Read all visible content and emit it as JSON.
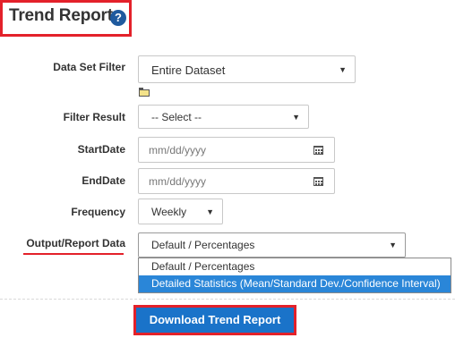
{
  "header": {
    "title": "Trend Report",
    "help_icon": "question-circle-icon"
  },
  "form": {
    "data_set_filter": {
      "label": "Data Set Filter",
      "value": "Entire Dataset"
    },
    "filter_result": {
      "label": "Filter Result",
      "value": "-- Select --"
    },
    "start_date": {
      "label": "StartDate",
      "placeholder": "mm/dd/yyyy"
    },
    "end_date": {
      "label": "EndDate",
      "placeholder": "mm/dd/yyyy"
    },
    "frequency": {
      "label": "Frequency",
      "value": "Weekly"
    },
    "output_report_data": {
      "label": "Output/Report Data",
      "value": "Default / Percentages",
      "options": [
        "Default / Percentages",
        "Detailed Statistics (Mean/Standard Dev./Confidence Interval)"
      ],
      "highlighted_option_index": 1
    }
  },
  "actions": {
    "download_label": "Download Trend Report"
  },
  "colors": {
    "accent_red": "#e3212a",
    "button_blue": "#1a73c9",
    "highlight_blue": "#2a86d8"
  }
}
